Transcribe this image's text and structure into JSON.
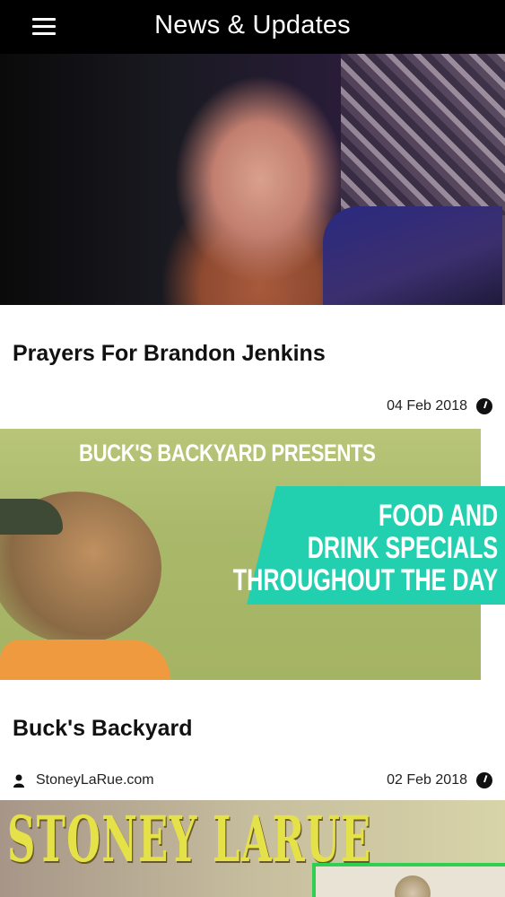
{
  "header": {
    "title": "News & Updates",
    "menu_icon": "hamburger-menu-icon"
  },
  "posts": [
    {
      "title": "Prayers For Brandon Jenkins",
      "date": "04 Feb 2018",
      "author": "",
      "image_description": "photo"
    },
    {
      "title": "Buck's Backyard",
      "date": "02 Feb 2018",
      "author": "StoneyLaRue.com",
      "image_heading": "BUCK'S BACKYARD PRESENTS",
      "image_banner_lines": [
        "FOOD AND",
        "DRINK SPECIALS",
        "THROUGHOUT THE DAY"
      ]
    },
    {
      "image_title": "STONEY LARUE"
    }
  ],
  "colors": {
    "header_bg": "#000000",
    "header_text": "#ffffff",
    "banner_teal": "#22d0b0",
    "image3_title_yellow": "#e4e248"
  }
}
